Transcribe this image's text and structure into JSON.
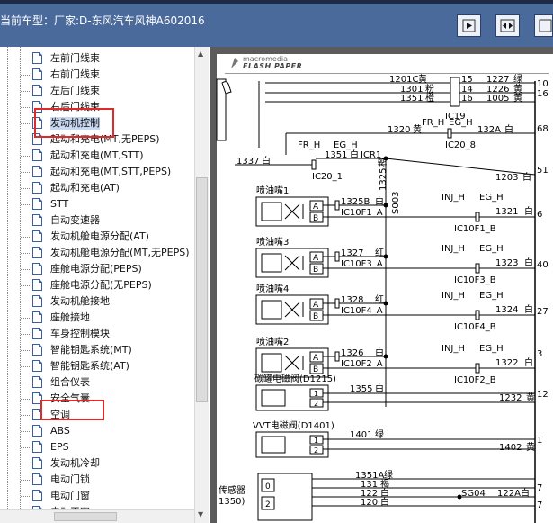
{
  "window": {
    "title": "当前车型：厂家:D-东风汽车风神A602016"
  },
  "tree": {
    "items": [
      {
        "label": "左前门线束"
      },
      {
        "label": "右前门线束"
      },
      {
        "label": "左后门线束"
      },
      {
        "label": "右后门线束"
      },
      {
        "label": "发动机控制",
        "selected": true
      },
      {
        "label": "起动和充电(MT,无PEPS)"
      },
      {
        "label": "起动和充电(MT,STT)"
      },
      {
        "label": "起动和充电(MT,STT,PEPS)"
      },
      {
        "label": "起动和充电(AT)"
      },
      {
        "label": "STT"
      },
      {
        "label": "自动变速器"
      },
      {
        "label": "发动机舱电源分配(AT)"
      },
      {
        "label": "发动机舱电源分配(MT,无PEPS)"
      },
      {
        "label": "座舱电源分配(PEPS)"
      },
      {
        "label": "座舱电源分配(无PEPS)"
      },
      {
        "label": "发动机舱接地"
      },
      {
        "label": "座舱接地"
      },
      {
        "label": "车身控制模块"
      },
      {
        "label": "智能钥匙系统(MT)"
      },
      {
        "label": "智能钥匙系统(AT)"
      },
      {
        "label": "组合仪表"
      },
      {
        "label": "安全气囊"
      },
      {
        "label": "空调"
      },
      {
        "label": "ABS"
      },
      {
        "label": "EPS"
      },
      {
        "label": "发动机冷却"
      },
      {
        "label": "电动门锁"
      },
      {
        "label": "电动门窗"
      },
      {
        "label": "电动天窗"
      }
    ]
  },
  "viewer": {
    "logo_top": "macromedia",
    "logo_bottom": "FLASH PAPER"
  },
  "diagram": {
    "top_rows": [
      {
        "left": "1201C",
        "color": "黄",
        "pin": "15",
        "right": "1227",
        "rcolor": "绿"
      },
      {
        "left": "1301",
        "color": "粉",
        "pin": "14",
        "right": "1226",
        "rcolor": "黄"
      },
      {
        "left": "1351",
        "color": "橙",
        "pin": "16",
        "right": "1005",
        "rcolor": "黄"
      }
    ],
    "ic19": "IC19",
    "fr_h_top": "FR_H",
    "eg_h_top": "EG_H",
    "w1320": "1320",
    "w1320_color": "黄",
    "w132a": "132A",
    "w132a_color": "白",
    "ic20_8": "IC20_8",
    "fr_h": "FR_H",
    "eg_h": "EG_H",
    "w1337": "1337",
    "w1337_color": "白",
    "w1351": "1351",
    "w1351_color": "白",
    "icr1": "ICR1",
    "ic20_1": "IC20_1",
    "w1203": "1203",
    "w1203_color": "白",
    "w1325": "1325",
    "w1325_color": "橙",
    "s003": "S003",
    "injectors": [
      {
        "name": "喷油嘴1",
        "wire": "1325B",
        "wcolor": "白",
        "conn": "IC10F1_A",
        "ret": "1321",
        "rcolor": "白",
        "rconn": "IC10F1_B"
      },
      {
        "name": "喷油嘴3",
        "wire": "1327",
        "wcolor": "红",
        "conn": "IC10F3_A",
        "ret": "1323",
        "rcolor": "白",
        "rconn": "IC10F3_B"
      },
      {
        "name": "喷油嘴4",
        "wire": "1328",
        "wcolor": "红",
        "conn": "IC10F4_A",
        "ret": "1324",
        "rcolor": "白",
        "rconn": "IC10F4_B"
      },
      {
        "name": "喷油嘴2",
        "wire": "1326",
        "wcolor": "白",
        "conn": "IC10F2_A",
        "ret": "1322",
        "rcolor": "白",
        "rconn": "IC10F2_B"
      }
    ],
    "inj_h": "INJ_H",
    "eg_h2": "EG_H",
    "pin_a": "A",
    "pin_b": "B",
    "canister": {
      "name": "碳罐电磁阀(D1215)",
      "wire": "1355",
      "wcolor": "白",
      "ret": "1232",
      "rcolor": "黄"
    },
    "vvt": {
      "name": "VVT电磁阀(D1401)",
      "wire": "1401",
      "wcolor": "绿",
      "ret": "1402",
      "rcolor": "黄"
    },
    "pin_1": "1",
    "pin_2": "2",
    "sensor_label": "传感器",
    "sensor_code": "1350)",
    "bottom_wires": [
      {
        "num": "1351A",
        "color": "绿"
      },
      {
        "num": "131",
        "color": "褐"
      },
      {
        "num": "122",
        "color": "白"
      },
      {
        "num": "120",
        "color": "白"
      }
    ],
    "sg04": "SG04",
    "w122a": "122A",
    "w122a_color": "白",
    "right_pins": [
      "10",
      "16",
      "68",
      "51",
      "6",
      "40",
      "27",
      "3",
      "12",
      "1",
      "7",
      "7"
    ],
    "sensor_pins": [
      "0",
      "2"
    ]
  },
  "colors": {
    "highlight": "#e02a2a",
    "titlebar": "#4a6a9c",
    "selection": "#c9d9f3"
  }
}
